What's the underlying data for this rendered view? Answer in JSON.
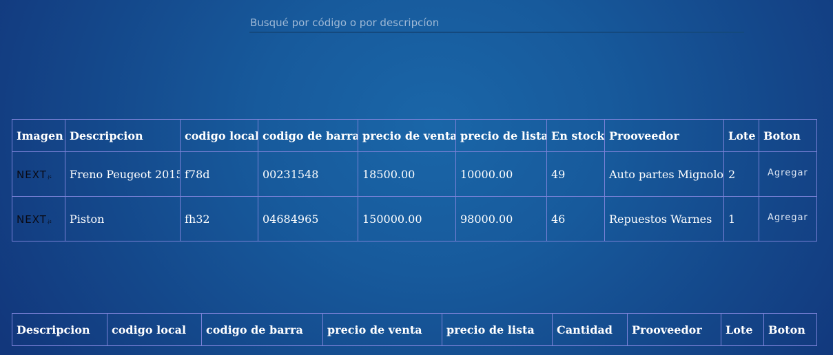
{
  "search": {
    "placeholder": "Busqué por código o por descripcíon",
    "value": ""
  },
  "products_table": {
    "headers": [
      "Imagen",
      "Descripcion",
      "codigo local",
      "codigo de barra",
      "precio de venta",
      "precio de lista",
      "En stock",
      "Prooveedor",
      "Lote",
      "Boton"
    ],
    "rows": [
      {
        "image_logo": "NEXT",
        "image_logo_suffix": ".js",
        "descripcion": "Freno Peugeot 2015",
        "codigo_local": "f78d",
        "codigo_barra": "00231548",
        "precio_venta": "18500.00",
        "precio_lista": "10000.00",
        "stock": "49",
        "proveedor": "Auto partes Mignolo",
        "lote": "2",
        "boton": "Agregar"
      },
      {
        "image_logo": "NEXT",
        "image_logo_suffix": ".js",
        "descripcion": "Piston",
        "codigo_local": "fh32",
        "codigo_barra": "04684965",
        "precio_venta": "150000.00",
        "precio_lista": "98000.00",
        "stock": "46",
        "proveedor": "Repuestos Warnes",
        "lote": "1",
        "boton": "Agregar"
      }
    ]
  },
  "cart_table": {
    "headers": [
      "Descripcion",
      "codigo local",
      "codigo de barra",
      "precio de venta",
      "precio de lista",
      "Cantidad",
      "Prooveedor",
      "Lote",
      "Boton"
    ],
    "rows": []
  },
  "colors": {
    "background_center": "#1a66a8",
    "background_edge": "#12377c",
    "table_border": "#7b82d8",
    "text": "#ffffff",
    "placeholder": "#9fb9d6"
  }
}
